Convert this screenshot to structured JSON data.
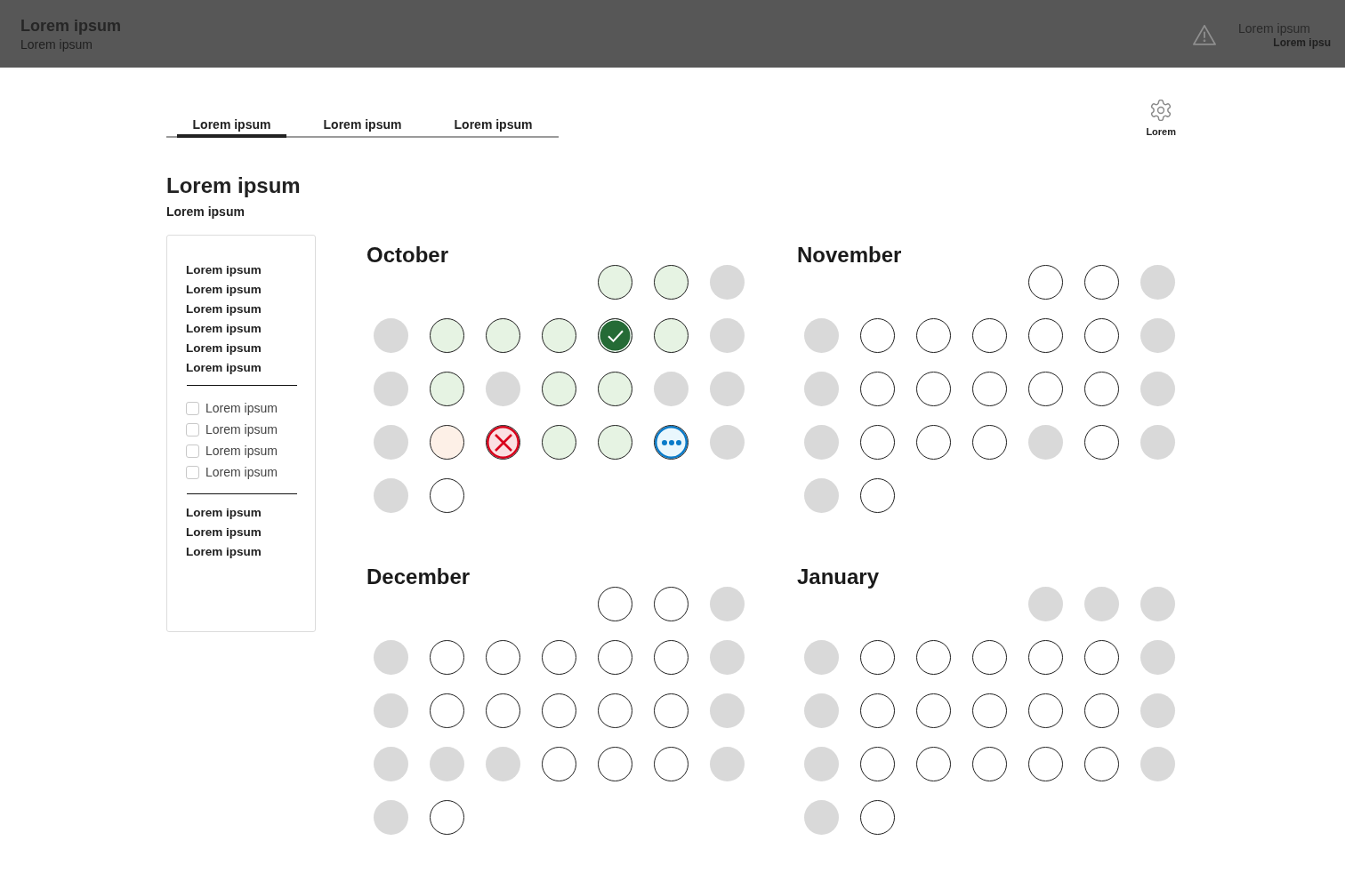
{
  "header": {
    "title": "Lorem ipsum",
    "subtitle": "Lorem ipsum",
    "account": {
      "line_1": "Lorem ipsum",
      "line_2": "Lorem ipsu"
    }
  },
  "tabs": [
    {
      "label": "Lorem ipsum",
      "selected": true
    },
    {
      "label": "Lorem ipsum",
      "selected": false
    },
    {
      "label": "Lorem ipsum",
      "selected": false
    }
  ],
  "settings": {
    "label": "Lorem"
  },
  "page": {
    "title": "Lorem ipsum",
    "subtitle": "Lorem ipsum"
  },
  "sidebar": {
    "top_items": [
      "Lorem ipsum",
      "Lorem ipsum",
      "Lorem ipsum",
      "Lorem ipsum",
      "Lorem ipsum",
      "Lorem ipsum"
    ],
    "filters": [
      {
        "label": "Lorem ipsum",
        "checked": false
      },
      {
        "label": "Lorem ipsum",
        "checked": false
      },
      {
        "label": "Lorem ipsum",
        "checked": false
      },
      {
        "label": "Lorem ipsum",
        "checked": false
      }
    ],
    "bottom_items": [
      "Lorem ipsum",
      "Lorem ipsum",
      "Lorem ipsum"
    ]
  },
  "months": [
    {
      "name": "October",
      "weeks": [
        [
          {
            "kind": "done"
          },
          {
            "kind": "done"
          },
          {
            "kind": "off"
          }
        ],
        [
          {
            "kind": "off"
          },
          {
            "kind": "done"
          },
          {
            "kind": "done"
          },
          {
            "kind": "done"
          },
          {
            "kind": "confirmed"
          },
          {
            "kind": "done"
          },
          {
            "kind": "off"
          }
        ],
        [
          {
            "kind": "off"
          },
          {
            "kind": "done"
          },
          {
            "kind": "off"
          },
          {
            "kind": "done"
          },
          {
            "kind": "done"
          },
          {
            "kind": "off"
          },
          {
            "kind": "off"
          }
        ],
        [
          {
            "kind": "off"
          },
          {
            "kind": "partial"
          },
          {
            "kind": "failed"
          },
          {
            "kind": "done"
          },
          {
            "kind": "done"
          },
          {
            "kind": "pending"
          },
          {
            "kind": "off"
          }
        ],
        [
          {
            "kind": "off"
          },
          {
            "kind": "open"
          }
        ]
      ]
    },
    {
      "name": "November",
      "weeks": [
        [
          {
            "kind": "open"
          },
          {
            "kind": "open"
          },
          {
            "kind": "off"
          }
        ],
        [
          {
            "kind": "off"
          },
          {
            "kind": "open"
          },
          {
            "kind": "open"
          },
          {
            "kind": "open"
          },
          {
            "kind": "open"
          },
          {
            "kind": "open"
          },
          {
            "kind": "off"
          }
        ],
        [
          {
            "kind": "off"
          },
          {
            "kind": "open"
          },
          {
            "kind": "open"
          },
          {
            "kind": "open"
          },
          {
            "kind": "open"
          },
          {
            "kind": "open"
          },
          {
            "kind": "off"
          }
        ],
        [
          {
            "kind": "off"
          },
          {
            "kind": "open"
          },
          {
            "kind": "open"
          },
          {
            "kind": "open"
          },
          {
            "kind": "off"
          },
          {
            "kind": "open"
          },
          {
            "kind": "off"
          }
        ],
        [
          {
            "kind": "off"
          },
          {
            "kind": "open"
          }
        ]
      ]
    },
    {
      "name": "December",
      "weeks": [
        [
          {
            "kind": "open"
          },
          {
            "kind": "open"
          },
          {
            "kind": "off"
          }
        ],
        [
          {
            "kind": "off"
          },
          {
            "kind": "open"
          },
          {
            "kind": "open"
          },
          {
            "kind": "open"
          },
          {
            "kind": "open"
          },
          {
            "kind": "open"
          },
          {
            "kind": "off"
          }
        ],
        [
          {
            "kind": "off"
          },
          {
            "kind": "open"
          },
          {
            "kind": "open"
          },
          {
            "kind": "open"
          },
          {
            "kind": "open"
          },
          {
            "kind": "open"
          },
          {
            "kind": "off"
          }
        ],
        [
          {
            "kind": "off"
          },
          {
            "kind": "off"
          },
          {
            "kind": "off"
          },
          {
            "kind": "open"
          },
          {
            "kind": "open"
          },
          {
            "kind": "open"
          },
          {
            "kind": "off"
          }
        ],
        [
          {
            "kind": "off"
          },
          {
            "kind": "open"
          }
        ]
      ]
    },
    {
      "name": "January",
      "weeks": [
        [
          {
            "kind": "off"
          },
          {
            "kind": "off"
          },
          {
            "kind": "off"
          }
        ],
        [
          {
            "kind": "off"
          },
          {
            "kind": "open"
          },
          {
            "kind": "open"
          },
          {
            "kind": "open"
          },
          {
            "kind": "open"
          },
          {
            "kind": "open"
          },
          {
            "kind": "off"
          }
        ],
        [
          {
            "kind": "off"
          },
          {
            "kind": "open"
          },
          {
            "kind": "open"
          },
          {
            "kind": "open"
          },
          {
            "kind": "open"
          },
          {
            "kind": "open"
          },
          {
            "kind": "off"
          }
        ],
        [
          {
            "kind": "off"
          },
          {
            "kind": "open"
          },
          {
            "kind": "open"
          },
          {
            "kind": "open"
          },
          {
            "kind": "open"
          },
          {
            "kind": "open"
          },
          {
            "kind": "off"
          }
        ],
        [
          {
            "kind": "off"
          },
          {
            "kind": "open"
          }
        ]
      ]
    }
  ]
}
